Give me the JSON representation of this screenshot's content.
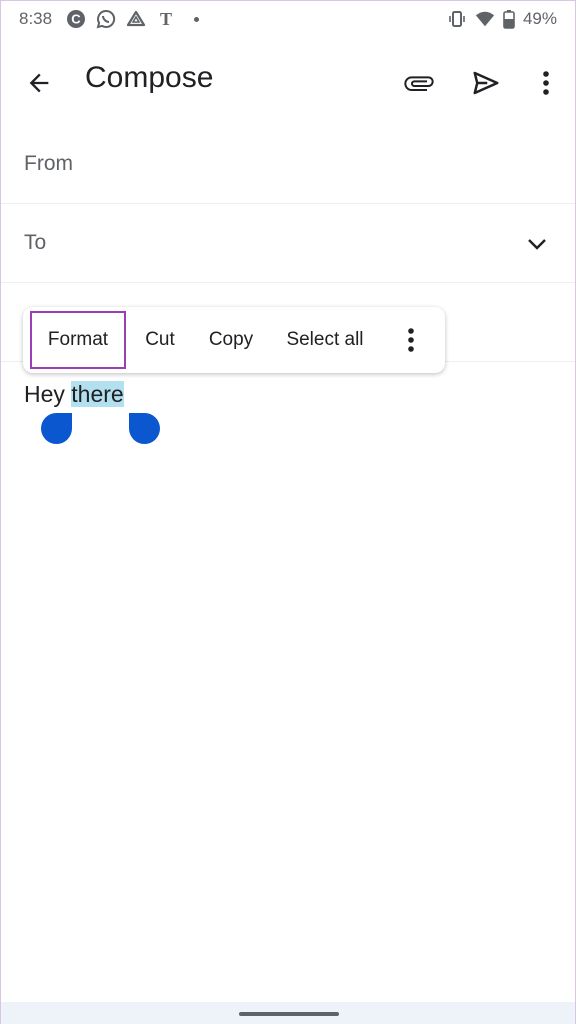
{
  "status_bar": {
    "time": "8:38",
    "notification_icons": [
      "c-app-icon",
      "whatsapp-icon",
      "drive-triangle-icon",
      "nyt-icon"
    ],
    "battery_percent": "49%"
  },
  "app_bar": {
    "title": "Compose"
  },
  "fields": {
    "from_label": "From",
    "to_label": "To"
  },
  "body": {
    "text_unselected": "Hey ",
    "text_selected": "there"
  },
  "context_menu": {
    "items": [
      {
        "label": "Format",
        "highlighted": true
      },
      {
        "label": "Cut"
      },
      {
        "label": "Copy"
      },
      {
        "label": "Select all"
      }
    ]
  },
  "colors": {
    "selection_highlight": "#b3e0ee",
    "selection_handle": "#0b57d0",
    "highlight_box": "#9c3fb5"
  }
}
